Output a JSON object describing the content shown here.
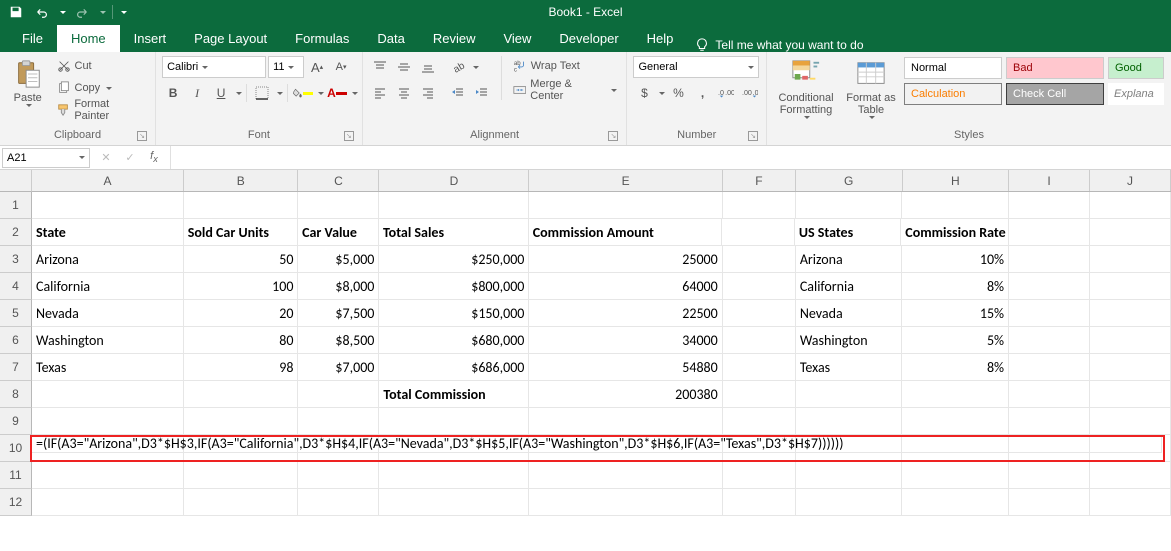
{
  "title": "Book1 - Excel",
  "tabs": {
    "file": "File",
    "home": "Home",
    "insert": "Insert",
    "page_layout": "Page Layout",
    "formulas": "Formulas",
    "data": "Data",
    "review": "Review",
    "view": "View",
    "developer": "Developer",
    "help": "Help"
  },
  "tellme": "Tell me what you want to do",
  "clipboard": {
    "paste": "Paste",
    "cut": "Cut",
    "copy": "Copy",
    "format_painter": "Format Painter",
    "label": "Clipboard"
  },
  "font": {
    "name": "Calibri",
    "size": "11",
    "label": "Font"
  },
  "alignment": {
    "wrap": "Wrap Text",
    "merge": "Merge & Center",
    "label": "Alignment"
  },
  "number": {
    "format": "General",
    "label": "Number"
  },
  "styles": {
    "cond": "Conditional Formatting",
    "table": "Format as Table",
    "normal": "Normal",
    "bad": "Bad",
    "good": "Good",
    "calc": "Calculation",
    "check": "Check Cell",
    "explan": "Explana",
    "label": "Styles"
  },
  "namebox": "A21",
  "columns": [
    "A",
    "B",
    "C",
    "D",
    "E",
    "F",
    "G",
    "H",
    "I",
    "J"
  ],
  "rows": [
    "1",
    "2",
    "3",
    "4",
    "5",
    "6",
    "7",
    "8",
    "9",
    "10",
    "11",
    "12"
  ],
  "sheet": {
    "r2": {
      "A": "State",
      "B": "Sold Car Units",
      "C": "Car Value",
      "D": "Total Sales",
      "E": "Commission Amount",
      "G": "US States",
      "H": "Commission Rate"
    },
    "r3": {
      "A": "Arizona",
      "B": "50",
      "C": "$5,000",
      "D": "$250,000",
      "E": "25000",
      "G": "Arizona",
      "H": "10%"
    },
    "r4": {
      "A": "California",
      "B": "100",
      "C": "$8,000",
      "D": "$800,000",
      "E": "64000",
      "G": "California",
      "H": "8%"
    },
    "r5": {
      "A": "Nevada",
      "B": "20",
      "C": "$7,500",
      "D": "$150,000",
      "E": "22500",
      "G": "Nevada",
      "H": "15%"
    },
    "r6": {
      "A": "Washington",
      "B": "80",
      "C": "$8,500",
      "D": "$680,000",
      "E": "34000",
      "G": "Washington",
      "H": "5%"
    },
    "r7": {
      "A": "Texas",
      "B": "98",
      "C": "$7,000",
      "D": "$686,000",
      "E": "54880",
      "G": "Texas",
      "H": "8%"
    },
    "r8": {
      "D": "Total Commission",
      "E": "200380"
    },
    "r10": {
      "formula": "=(IF(A3=\"Arizona\",D3*$H$3,IF(A3=\"California\",D3*$H$4,IF(A3=\"Nevada\",D3*$H$5,IF(A3=\"Washington\",D3*$H$6,IF(A3=\"Texas\",D3*$H$7))))))"
    }
  }
}
